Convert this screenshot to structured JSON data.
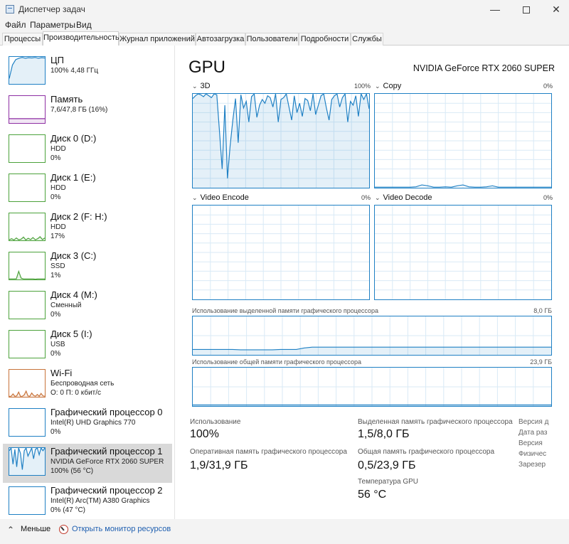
{
  "window": {
    "title": "Диспетчер задач",
    "minimize": "—",
    "close": "✕"
  },
  "menu": [
    "Файл",
    "Параметры",
    "Вид"
  ],
  "tabs": [
    {
      "label": "Процессы"
    },
    {
      "label": "Производительность",
      "active": true
    },
    {
      "label": "Журнал приложений"
    },
    {
      "label": "Автозагрузка"
    },
    {
      "label": "Пользователи"
    },
    {
      "label": "Подробности"
    },
    {
      "label": "Службы"
    }
  ],
  "sidebar": [
    {
      "name": "ЦП",
      "line2": "100% 4,48 ГГц",
      "line3": "",
      "color": "#1f80c4"
    },
    {
      "name": "Память",
      "line2": "7,6/47,8 ГБ (16%)",
      "line3": "",
      "color": "#8e2fa3"
    },
    {
      "name": "Диск 0 (D:)",
      "line2": "HDD",
      "line3": "0%",
      "color": "#4ca23b"
    },
    {
      "name": "Диск 1 (E:)",
      "line2": "HDD",
      "line3": "0%",
      "color": "#4ca23b"
    },
    {
      "name": "Диск 2 (F: H:)",
      "line2": "HDD",
      "line3": "17%",
      "color": "#4ca23b"
    },
    {
      "name": "Диск 3 (C:)",
      "line2": "SSD",
      "line3": "1%",
      "color": "#4ca23b"
    },
    {
      "name": "Диск 4 (M:)",
      "line2": "Сменный",
      "line3": "0%",
      "color": "#4ca23b"
    },
    {
      "name": "Диск 5 (I:)",
      "line2": "USB",
      "line3": "0%",
      "color": "#4ca23b"
    },
    {
      "name": "Wi-Fi",
      "line2": "Беспроводная сеть",
      "line3": "О: 0 П: 0 кбит/с",
      "color": "#c8733a"
    },
    {
      "name": "Графический процессор 0",
      "line2": "Intel(R) UHD Graphics 770",
      "line3": "0%",
      "color": "#1f80c4"
    },
    {
      "name": "Графический процессор 1",
      "line2": "NVIDIA GeForce RTX 2060 SUPER",
      "line3": "100% (56 °C)",
      "color": "#1f80c4",
      "selected": true
    },
    {
      "name": "Графический процессор 2",
      "line2": "Intel(R) Arc(TM) A380 Graphics",
      "line3": "0% (47 °C)",
      "color": "#1f80c4"
    }
  ],
  "main": {
    "title": "GPU",
    "model": "NVIDIA GeForce RTX 2060 SUPER",
    "engines": [
      {
        "label": "3D",
        "max": "100%",
        "chevron": "⌄"
      },
      {
        "label": "Copy",
        "max": "0%",
        "chevron": "⌄"
      },
      {
        "label": "Video Encode",
        "max": "0%",
        "chevron": "⌄"
      },
      {
        "label": "Video Decode",
        "max": "0%",
        "chevron": "⌄"
      }
    ],
    "dedicated_memory": {
      "label": "Использование выделенной памяти графического процессора",
      "max": "8,0 ГБ"
    },
    "shared_memory": {
      "label": "Использование общей памяти графического процессора",
      "max": "23,9 ГБ"
    },
    "stats": [
      {
        "label": "Использование",
        "value": "100%"
      },
      {
        "label": "Выделенная память графического процессора",
        "value": "1,5/8,0 ГБ"
      },
      {
        "label": "Оперативная память графического процессора",
        "value": "1,9/31,9 ГБ"
      },
      {
        "label": "Общая память графического процессора",
        "value": "0,5/23,9 ГБ"
      },
      {
        "label": "Температура GPU",
        "value": "56 °C"
      }
    ],
    "side_stats": [
      "Версия д",
      "Дата раз",
      "Версия",
      "Физичес",
      "Зарезер"
    ]
  },
  "footer": {
    "less": "Меньше",
    "less_chevron": "⌃",
    "link": "Открыть монитор ресурсов"
  },
  "series": {
    "gpu_3d": [
      95,
      98,
      100,
      99,
      97,
      100,
      98,
      96,
      100,
      99,
      60,
      20,
      88,
      10,
      45,
      72,
      95,
      48,
      99,
      85,
      92,
      70,
      97,
      100,
      75,
      88,
      94,
      90,
      98,
      96,
      86,
      100,
      70,
      94,
      96,
      100,
      86,
      72,
      98,
      80,
      90,
      76,
      95,
      93,
      82,
      100,
      78,
      88,
      98,
      100,
      85,
      72,
      94,
      98,
      100,
      86,
      96,
      100,
      70,
      92,
      88,
      98,
      76,
      100,
      94,
      100,
      84
    ],
    "copy": [
      0,
      0,
      0,
      0,
      0,
      0,
      0,
      1,
      3,
      2,
      0,
      0,
      1,
      0,
      2,
      3,
      1,
      0,
      0,
      1,
      2,
      0,
      0,
      0,
      0,
      0,
      0,
      0,
      0,
      0,
      0
    ],
    "dedicated_mem": [
      14,
      14,
      14,
      14,
      14,
      14,
      13,
      13,
      13,
      13,
      13,
      14,
      14,
      14,
      18,
      20,
      20,
      20,
      20,
      20,
      20,
      20,
      20,
      20,
      20,
      20,
      20,
      20,
      20,
      20,
      20,
      20,
      20,
      20,
      20,
      20,
      20,
      20,
      20,
      20,
      20,
      20,
      20,
      20,
      20,
      20
    ],
    "cpu_thumb": [
      20,
      70,
      90,
      95,
      98,
      95,
      97,
      96,
      98,
      95,
      97,
      96
    ],
    "mem_thumb": [
      16,
      16,
      16,
      16,
      16,
      16,
      16,
      16,
      16,
      16,
      16,
      16
    ],
    "disk2_thumb": [
      0,
      20,
      5,
      30,
      0,
      15,
      40,
      5,
      25,
      10,
      35,
      0,
      20,
      45,
      10,
      30
    ],
    "disk3_thumb": [
      0,
      0,
      0,
      5,
      60,
      10,
      0,
      0,
      0,
      0,
      0,
      2,
      0,
      0,
      0,
      0
    ],
    "wifi_thumb": [
      5,
      0,
      30,
      5,
      10,
      50,
      5,
      0,
      20,
      60,
      10,
      5,
      40,
      15,
      0,
      25,
      5,
      35,
      10,
      0
    ],
    "gpu1_thumb": [
      90,
      100,
      40,
      95,
      30,
      100,
      80,
      20,
      90,
      100,
      70,
      85,
      100,
      60,
      95,
      100,
      75,
      100,
      90,
      100
    ]
  }
}
